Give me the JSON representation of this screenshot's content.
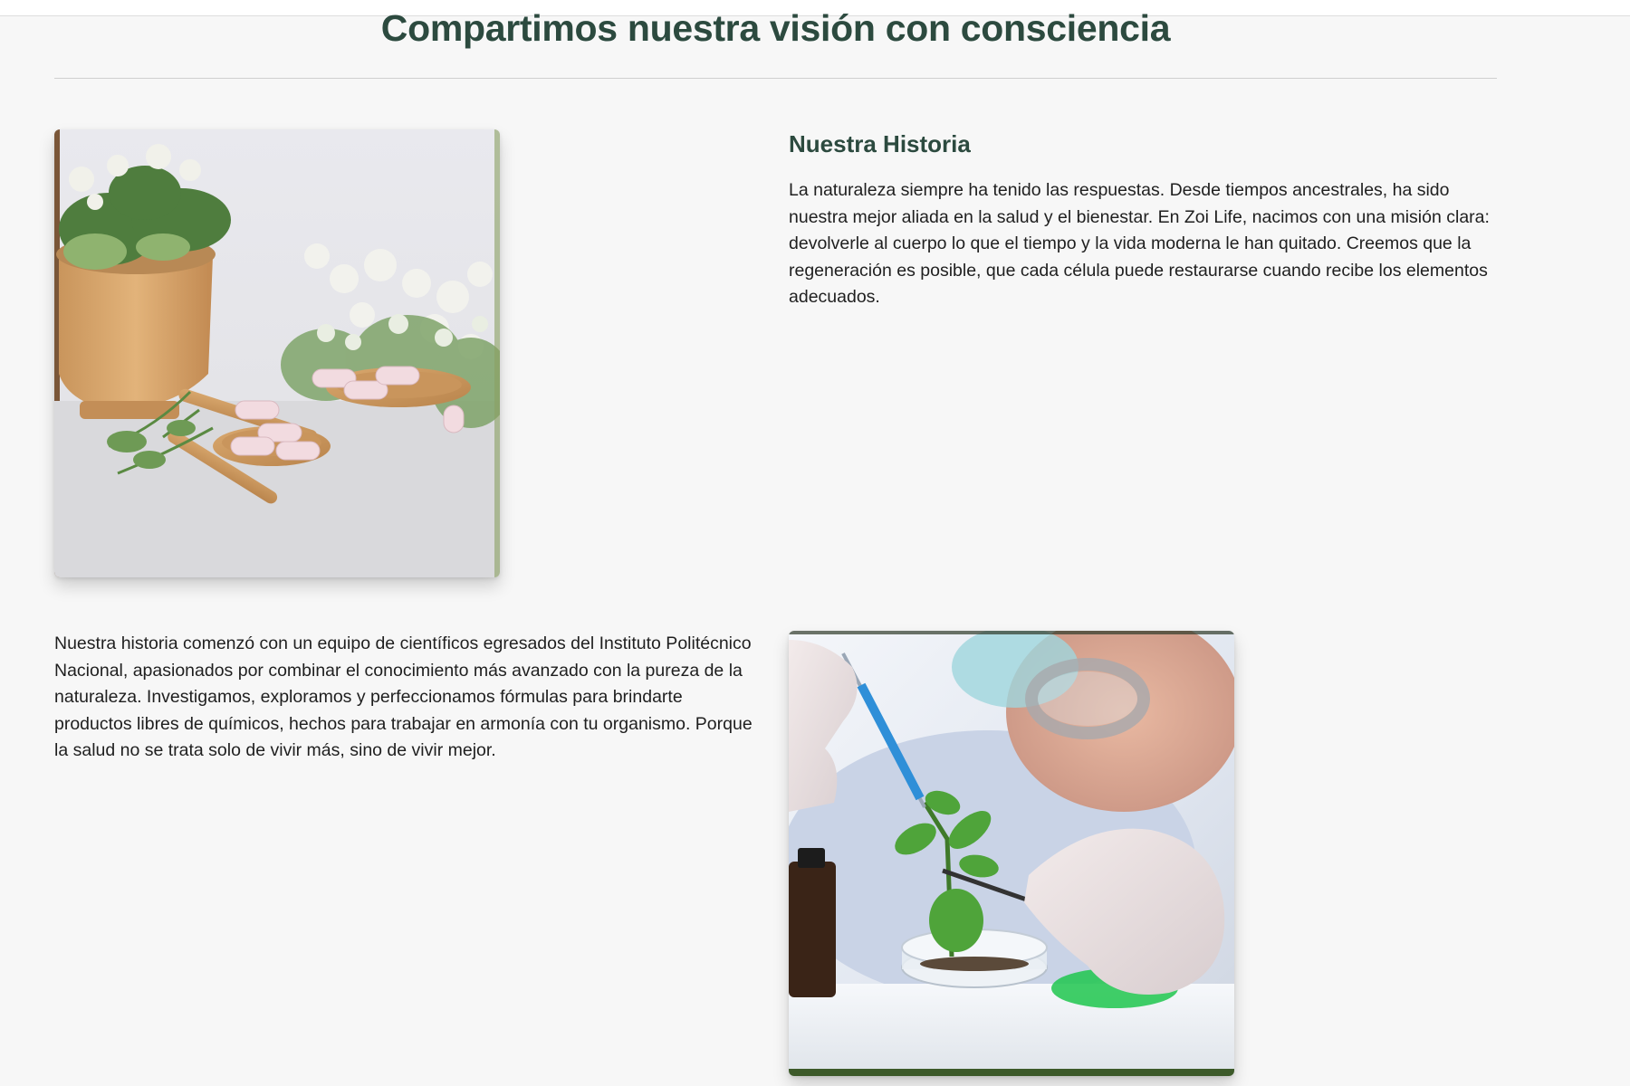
{
  "section": {
    "title": "Compartimos nuestra visión con consciencia"
  },
  "story": {
    "heading": "Nuestra Historia",
    "paragraph_1": "La naturaleza siempre ha tenido las respuestas. Desde tiempos ancestrales, ha sido nuestra mejor aliada en la salud y el bienestar. En Zoi Life, nacimos con una misión clara: devolverle al cuerpo lo que el tiempo y la vida moderna le han quitado. Creemos que la regeneración es posible, que cada célula puede restaurarse cuando recibe los elementos adecuados.",
    "paragraph_2": "Nuestra historia comenzó con un equipo de científicos egresados del Instituto Politécnico Nacional, apasionados por combinar el conocimiento más avanzado con la pureza de la naturaleza. Investigamos, exploramos y perfeccionamos fórmulas para brindarte productos libres de químicos, hechos para trabajar en armonía con tu organismo. Porque la salud no se trata solo de vivir más, sino de vivir mejor."
  },
  "images": {
    "herbs": "herbal-capsules-photo",
    "lab": "scientist-plant-lab-photo"
  },
  "colors": {
    "heading": "#2c4a3f",
    "background": "#f7f7f7",
    "text": "#1f1f1f"
  }
}
